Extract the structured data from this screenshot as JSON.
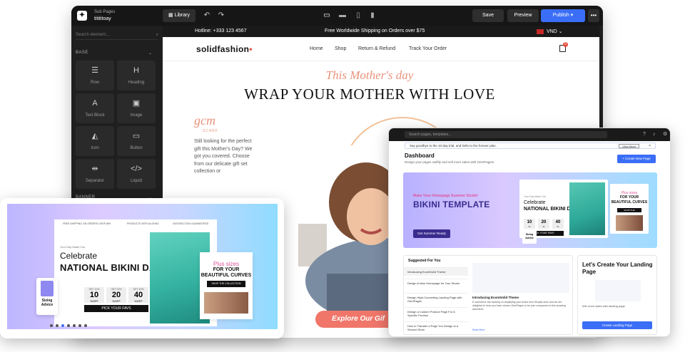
{
  "builder": {
    "breadcrumb_parent": "Sub Pages",
    "breadcrumb_page": "titititoay",
    "library_label": "Library",
    "save_label": "Save",
    "preview_label": "Preview",
    "publish_label": "Publish",
    "search_placeholder": "Search element...",
    "section_base": "BASE",
    "section_banner": "BANNER",
    "elements": [
      {
        "label": "Row",
        "glyph": "☰"
      },
      {
        "label": "Heading",
        "glyph": "H"
      },
      {
        "label": "Text Block",
        "glyph": "A"
      },
      {
        "label": "Image",
        "glyph": "▣"
      },
      {
        "label": "Icon",
        "glyph": "◭"
      },
      {
        "label": "Button",
        "glyph": "▭"
      },
      {
        "label": "Separator",
        "glyph": "⇹"
      },
      {
        "label": "Liquid",
        "glyph": "</>"
      }
    ]
  },
  "site": {
    "hotline": "Hotline: +333 123 4567",
    "shipping": "Free Worldwide Shipping on Orders over $75",
    "currency": "VND",
    "brand": "solidfashion",
    "nav": [
      "Home",
      "Shop",
      "Return & Refund",
      "Track Your Order"
    ],
    "cart_count": "0",
    "hero_subtitle": "This Mother's day",
    "hero_title": "WRAP YOUR MOTHER WITH LOVE",
    "gcm_logo": "gcm",
    "gcm_sub": "SCARF",
    "body_copy": "Still looking for the perfect gift this Mother's Day? We got you covered. Choose from our delicate gift set collection or",
    "cta": "Explore Our Gif"
  },
  "dashboard": {
    "search_placeholder": "Search pages, templates...",
    "notice": "Say goodbye to the 10-day trial, and hello to the forever plan.",
    "view_more": "View More",
    "title": "Dashboard",
    "subtitle": "Design your pages swiftly and sell more sales with GemPages!",
    "create_label": "+ Create New Page",
    "banner_kicker": "Make Your Homepage Summer Sizzlin'",
    "banner_title": "BIKINI TEMPLATE",
    "banner_cta": "Get Summer Ready",
    "card_pre": "Your Day Made Out",
    "card_t1": "Celebrate",
    "card_t2": "NATIONAL BIKINI DAY",
    "card_chips": [
      {
        "n": "10",
        "u": "%"
      },
      {
        "n": "20",
        "u": "%"
      },
      {
        "n": "40",
        "u": "%"
      }
    ],
    "card_btn": "PICK YOUR FAVS",
    "plus_1": "Plus sizes",
    "plus_2": "FOR YOUR BEAUTIFUL CURVES",
    "plus_btn": "SHOP THE COLLECTION",
    "sizing": "Sizing Advice",
    "suggested_title": "Suggested For You",
    "suggested_items": [
      "Introducing EcomSolid Theme",
      "Design A New Homepage for Your Stores",
      "Design High-Converting Landing Page with GemPages",
      "Design a Custom Product Page For A Specific Product",
      "How to Transfer a Page You Design to a Second Store"
    ],
    "sug_article_title": "Introducing EcomSolid Theme",
    "sug_article_desc": "E-commerce are working on amplifying your brand new Shopify store and we are delighted to hear you have chosen GemPages to be your companion in this amazing adventure.",
    "read_more": "Read More",
    "lp_title": "Let's Create Your Landing Page",
    "lp_desc": "Win more sales with landing page",
    "lp_btn": "Create Landing Page"
  },
  "tablet": {
    "strip": [
      "FREE SHIPPING ON ORDERS OVER $99",
      "PRODUCTS WITH ALOHAS",
      "SATISFACTION GUARANTEED"
    ],
    "pre": "Your Day Made Out",
    "t1": "Celebrate",
    "t2": "NATIONAL BIKINI DAY",
    "chips": [
      {
        "top": "GET 10%",
        "n": "10",
        "bot": "%OFF"
      },
      {
        "top": "GET 20%",
        "n": "20",
        "bot": "%OFF"
      },
      {
        "top": "GET 40%",
        "n": "40",
        "bot": "%OFF"
      }
    ],
    "btn": "PICK YOUR FAVS",
    "plus_1": "Plus sizes",
    "plus_2": "FOR YOUR BEAUTIFUL CURVES",
    "plus_btn": "SHOP THE COLLECTION",
    "sizing": "Sizing Advice"
  },
  "colors": {
    "accent": "#3b6ef6",
    "coral": "#f0766a",
    "peach": "#e8927c"
  }
}
